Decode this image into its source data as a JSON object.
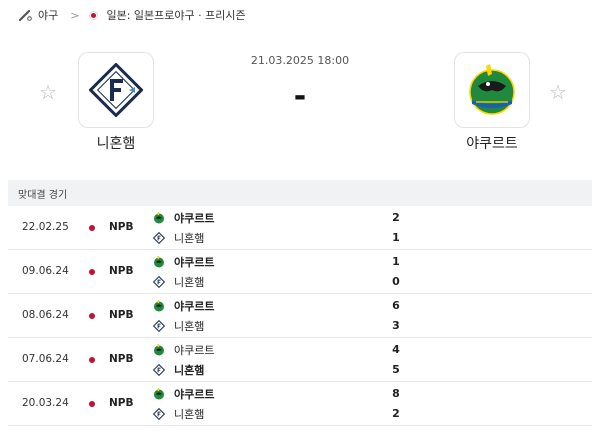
{
  "breadcrumb": {
    "sport": "야구",
    "separator": ">",
    "league": "일본: 일본프로야구 · 프리시즌"
  },
  "match": {
    "datetime": "21.03.2025 18:00",
    "score": "-",
    "home_team": "니혼햄",
    "away_team": "야쿠르트"
  },
  "h2h": {
    "title": "맞대결 경기",
    "rows": [
      {
        "date": "22.02.25",
        "league": "NPB",
        "team1": "야쿠르트",
        "team2": "니혼햄",
        "score1": "2",
        "score2": "1",
        "winner": 1
      },
      {
        "date": "09.06.24",
        "league": "NPB",
        "team1": "야쿠르트",
        "team2": "니혼햄",
        "score1": "1",
        "score2": "0",
        "winner": 1
      },
      {
        "date": "08.06.24",
        "league": "NPB",
        "team1": "야쿠르트",
        "team2": "니혼햄",
        "score1": "6",
        "score2": "3",
        "winner": 1
      },
      {
        "date": "07.06.24",
        "league": "NPB",
        "team1": "야쿠르트",
        "team2": "니혼햄",
        "score1": "4",
        "score2": "5",
        "winner": 2
      },
      {
        "date": "20.03.24",
        "league": "NPB",
        "team1": "야쿠르트",
        "team2": "니혼햄",
        "score1": "8",
        "score2": "2",
        "winner": 1
      }
    ]
  },
  "colors": {
    "japan_dot": "#c8102e",
    "section_bg": "#f0f2f4",
    "fighters_navy": "#1a2c4e",
    "swallows_green": "#1f8a3b"
  },
  "icons": {
    "sport": "baseball-bat-icon",
    "favorite": "star-outline-icon"
  }
}
